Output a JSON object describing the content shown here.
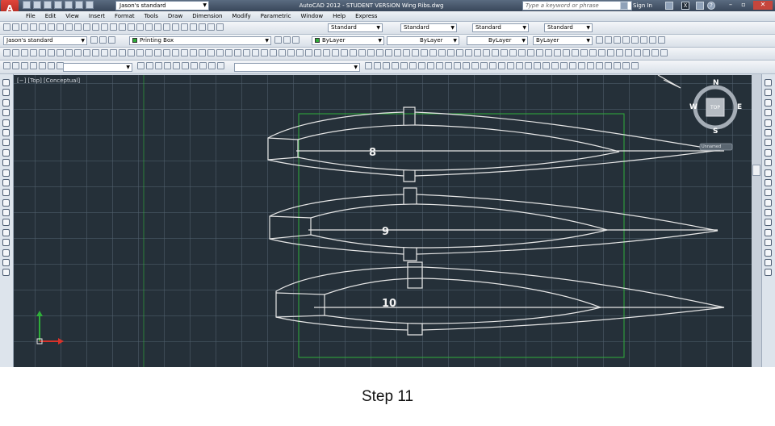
{
  "window": {
    "app_title": "AutoCAD 2012 - STUDENT VERSION    Wing Ribs.dwg",
    "workspace": "Jason's standard",
    "search_placeholder": "Type a keyword or phrase",
    "sign_in": "Sign In"
  },
  "menu": [
    "File",
    "Edit",
    "View",
    "Insert",
    "Format",
    "Tools",
    "Draw",
    "Dimension",
    "Modify",
    "Parametric",
    "Window",
    "Help",
    "Express"
  ],
  "toolbar": {
    "text_style": "Standard",
    "dim_style": "Standard",
    "table_style": "Standard",
    "multileader_style": "Standard",
    "workspace_combo": "Jason's standard",
    "layer": "Printing Box",
    "color": "ByLayer",
    "linetype": "ByLayer",
    "lineweight": "ByLayer",
    "plot_style": "ByLayer"
  },
  "viewport": {
    "label": "[−] [Top] [Conceptual]"
  },
  "viewcube": {
    "top": "TOP",
    "north": "N",
    "south": "S",
    "east": "E",
    "west": "W",
    "wcs": "Unnamed"
  },
  "ribs": [
    {
      "label": "8"
    },
    {
      "label": "9"
    },
    {
      "label": "10"
    }
  ],
  "colors": {
    "canvas_bg": "#253039",
    "rib_line": "#e6e6e6",
    "print_box": "#2fae3a",
    "ucs_x": "#d8322a",
    "ucs_y": "#2fae3a"
  },
  "caption": "Step 11"
}
